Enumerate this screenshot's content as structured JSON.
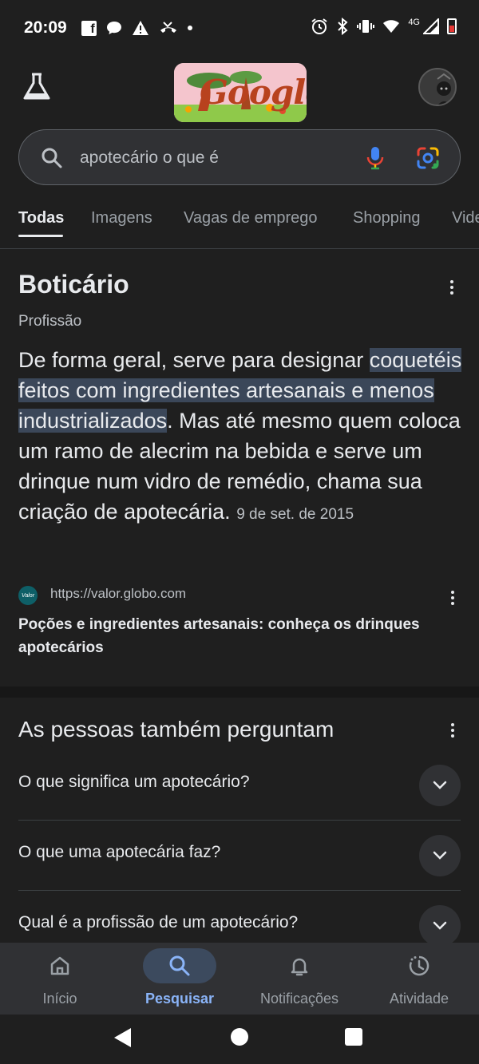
{
  "status_bar": {
    "time": "20:09",
    "network_label": "4G"
  },
  "header": {
    "doodle_text": "Google"
  },
  "search": {
    "query": "apotecário o que é"
  },
  "tabs": [
    {
      "label": "Todas",
      "active": true
    },
    {
      "label": "Imagens",
      "active": false
    },
    {
      "label": "Vagas de emprego",
      "active": false
    },
    {
      "label": "Shopping",
      "active": false
    },
    {
      "label": "Vide",
      "active": false
    }
  ],
  "featured": {
    "title": "Boticário",
    "subtitle": "Profissão",
    "body_before": "De forma geral, serve para designar ",
    "body_highlight": "coquetéis feitos com ingredientes artesanais e menos industrializados",
    "body_after": ". Mas até mesmo quem coloca um ramo de alecrim na bebida e serve um drinque num vidro de remédio, chama sua criação de apotecária.",
    "date": "9 de set. de 2015",
    "source_favicon_text": "Valor",
    "source_url": "https://valor.globo.com",
    "source_title": "Poções e ingredientes artesanais: conheça os drinques apotecários"
  },
  "paa": {
    "title": "As pessoas também perguntam",
    "questions": [
      "O que significa um apotecário?",
      "O que uma apotecária faz?",
      "Qual é a profissão de um apotecário?"
    ]
  },
  "bottom_nav": [
    {
      "label": "Início",
      "icon": "home-icon",
      "active": false
    },
    {
      "label": "Pesquisar",
      "icon": "search-icon",
      "active": true
    },
    {
      "label": "Notificações",
      "icon": "bell-icon",
      "active": false
    },
    {
      "label": "Atividade",
      "icon": "activity-icon",
      "active": false
    }
  ],
  "colors": {
    "background": "#1f1f1f",
    "accent": "#8ab4f8",
    "highlight": "#3b4759"
  }
}
